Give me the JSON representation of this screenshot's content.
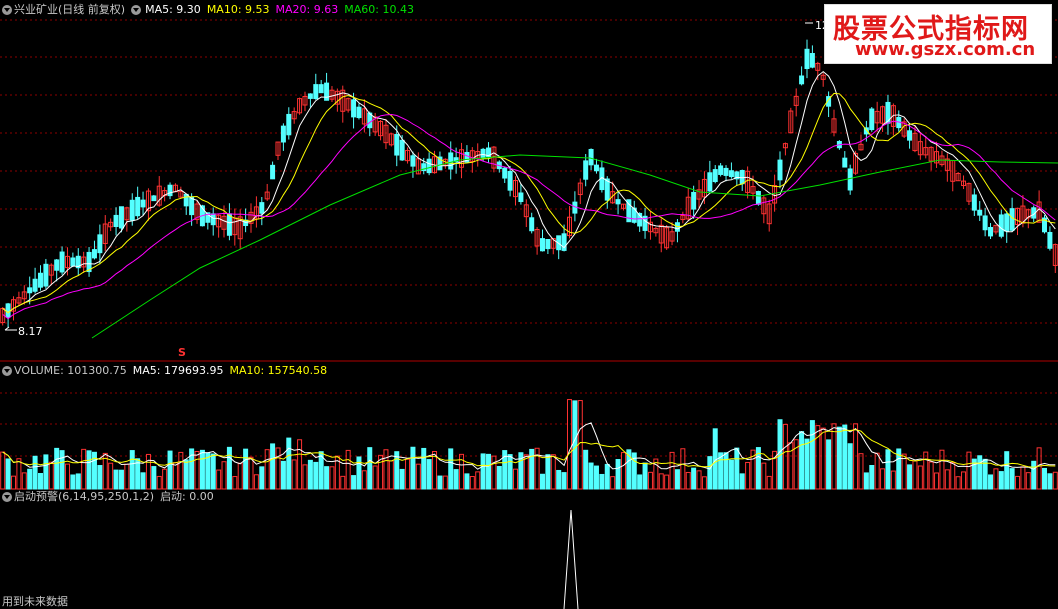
{
  "colors": {
    "up": "#ff3232",
    "down": "#54ffff",
    "ma5": "#ffffff",
    "ma10": "#ffff00",
    "ma20": "#ff00ff",
    "ma60": "#00e000",
    "grid": "#8b0000",
    "border": "#b00000",
    "white": "#ffffff",
    "gray": "#c8c8c8"
  },
  "header": {
    "title": "兴业矿业(日线 前复权)",
    "ma5": "MA5: 9.30",
    "ma10": "MA10: 9.53",
    "ma20": "MA20: 9.63",
    "ma60": "MA60: 10.43"
  },
  "price_labels": {
    "high": "12.",
    "low": "8.17",
    "signal": "S"
  },
  "volume_header": {
    "volume": "VOLUME: 101300.75",
    "ma5": "MA5: 179693.95",
    "ma10": "MA10: 157540.58"
  },
  "indicator_header": {
    "name": "启动预警(6,14,95,250,1,2)",
    "value": "启动: 0.00"
  },
  "footer": "用到未来数据",
  "watermark": {
    "line1": "股票公式指标网",
    "line2": "www.gszx.com.cn"
  },
  "chart_data": [
    {
      "type": "candlestick",
      "title": "兴业矿业(日线 前复权)",
      "low_marker": 8.17,
      "high_marker": "12.",
      "series": [
        {
          "name": "MA5",
          "last": 9.3
        },
        {
          "name": "MA10",
          "last": 9.53
        },
        {
          "name": "MA20",
          "last": 9.63
        },
        {
          "name": "MA60",
          "last": 10.43
        }
      ]
    },
    {
      "type": "bar",
      "title": "VOLUME",
      "series": [
        {
          "name": "VOLUME",
          "last": 101300.75
        },
        {
          "name": "MA5",
          "last": 179693.95
        },
        {
          "name": "MA10",
          "last": 157540.58
        }
      ]
    },
    {
      "type": "line",
      "title": "启动预警(6,14,95,250,1,2)",
      "series": [
        {
          "name": "启动",
          "last": 0.0
        }
      ]
    }
  ]
}
